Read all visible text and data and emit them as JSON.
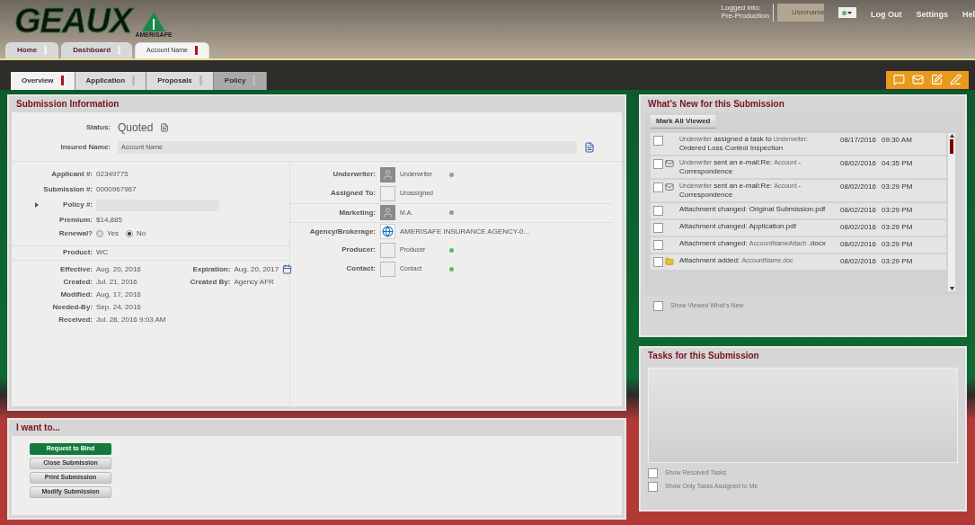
{
  "header": {
    "logo": "GEAUX",
    "logo_sub": "AMERISAFE",
    "login_lines": [
      "Logged into:",
      "Pre-Production"
    ],
    "username": "Username",
    "links": [
      "Log Out",
      "Settings",
      "Hel"
    ]
  },
  "top_tabs": [
    {
      "label": "Home",
      "selected": false
    },
    {
      "label": "Dashboard",
      "selected": false
    },
    {
      "label": "Account Name",
      "selected": true
    }
  ],
  "sub_tabs": [
    {
      "label": "Overview",
      "selected": true
    },
    {
      "label": "Application",
      "selected": false
    },
    {
      "label": "Proposals",
      "selected": false
    },
    {
      "label": "Policy",
      "selected": false
    }
  ],
  "submission": {
    "title": "Submission Information",
    "status_label": "Status:",
    "status": "Quoted",
    "insured_label": "Insured Name:",
    "insured": "Account Name",
    "ids": [
      {
        "label": "Applicant #:",
        "value": "02349775",
        "kind": "text"
      },
      {
        "label": "Submission #:",
        "value": "0000967967",
        "kind": "text"
      },
      {
        "label": "Policy #:",
        "kind": "field"
      },
      {
        "label": "Premium:",
        "value": "$14,885",
        "kind": "text"
      }
    ],
    "renewal": {
      "label": "Renewal?",
      "options": [
        {
          "label": "Yes",
          "selected": false
        },
        {
          "label": "No",
          "selected": true
        }
      ]
    },
    "product": {
      "label": "Product:",
      "value": "WC"
    },
    "dates_left": [
      {
        "label": "Effective:",
        "value": "Aug. 20, 2016"
      },
      {
        "label": "Created:",
        "value": "Jul. 21, 2016"
      },
      {
        "label": "Modified:",
        "value": "Aug. 17, 2016"
      },
      {
        "label": "Needed-By:",
        "value": "Sep. 24, 2016"
      },
      {
        "label": "Received:",
        "value": "Jul. 28, 2016 9:03 AM"
      }
    ],
    "dates_right": [
      {
        "label": "Expiration:",
        "value": "Aug. 20, 2017",
        "kind": "calendar"
      },
      {
        "label": "Created By:",
        "value": "Agency AFR",
        "kind": "text"
      }
    ],
    "contacts": [
      {
        "label": "Underwriter:",
        "value": "Underwriter",
        "kind": "person",
        "color": "#9a9a9a"
      },
      {
        "label": "Assigned To:",
        "value": "Unassigned",
        "kind": "blank"
      },
      {
        "label": "Marketing:",
        "value": "M.A.",
        "kind": "person",
        "color": "#9a9a9a"
      },
      {
        "label": "Agency/Brokerage:",
        "value": "AMERISAFE INSURANCE AGENCY-0...",
        "kind": "agency"
      },
      {
        "label": "Producer:",
        "value": "Producer",
        "kind": "blank",
        "color": "#5cb85c"
      },
      {
        "label": "Contact:",
        "value": "Contact",
        "kind": "blank",
        "color": "#5cb85c"
      }
    ]
  },
  "actions": {
    "title": "I want to...",
    "buttons": [
      {
        "label": "Request to Bind",
        "kind": "primary"
      },
      {
        "label": "Close Submission",
        "kind": "normal"
      },
      {
        "label": "Print Submission",
        "kind": "normal"
      },
      {
        "label": "Modify Submission",
        "kind": "normal"
      }
    ]
  },
  "whats_new": {
    "title": "What's New for this Submission",
    "mark_all": "Mark All Viewed",
    "items": [
      {
        "checked": false,
        "kind": "task",
        "parts": [
          {
            "kind": "small",
            "text": "Underwriter"
          },
          {
            "kind": "normal",
            "text": "assigned a task to"
          },
          {
            "kind": "small",
            "text": "Underwriter:"
          },
          {
            "kind": "normal",
            "text": "Ordered Loss Control Inspection"
          }
        ],
        "date": "08/17/2016",
        "time": "09:30 AM"
      },
      {
        "checked": false,
        "kind": "email",
        "parts": [
          {
            "kind": "small",
            "text": "Underwriter"
          },
          {
            "kind": "normal",
            "text": "sent an e-mail:Re:"
          },
          {
            "kind": "small",
            "text": "Account"
          },
          {
            "kind": "normal",
            "text": "-"
          },
          {
            "kind": "normal",
            "text": "Correspondence"
          }
        ],
        "date": "08/02/2016",
        "time": "04:35 PM"
      },
      {
        "checked": false,
        "kind": "email",
        "parts": [
          {
            "kind": "small",
            "text": "Underwriter"
          },
          {
            "kind": "normal",
            "text": "sent an e-mail:Re:"
          },
          {
            "kind": "small",
            "text": "Account"
          },
          {
            "kind": "normal",
            "text": "-"
          },
          {
            "kind": "normal",
            "text": "Correspondence"
          }
        ],
        "date": "08/02/2016",
        "time": "03:29 PM"
      },
      {
        "checked": false,
        "kind": "change",
        "parts": [
          {
            "kind": "normal",
            "text": "Attachment changed: Original Submission.pdf"
          }
        ],
        "date": "08/02/2016",
        "time": "03:29 PM"
      },
      {
        "checked": false,
        "kind": "change",
        "parts": [
          {
            "kind": "normal",
            "text": "Attachment changed:"
          },
          {
            "kind": "normal",
            "text": "Application.pdf"
          }
        ],
        "date": "08/02/2016",
        "time": "03:29 PM"
      },
      {
        "checked": false,
        "kind": "change",
        "parts": [
          {
            "kind": "normal",
            "text": "Attachment changed:"
          },
          {
            "kind": "small",
            "text": "AccountNameAttach"
          },
          {
            "kind": "normal",
            "text": ".docx"
          }
        ],
        "date": "08/02/2016",
        "time": "03:29 PM"
      },
      {
        "checked": false,
        "kind": "attachment",
        "parts": [
          {
            "kind": "normal",
            "text": "Attachment added:"
          },
          {
            "kind": "small",
            "text": "AccountName.doc"
          }
        ],
        "date": "08/02/2016",
        "time": "03:29 PM"
      }
    ],
    "show_viewed": {
      "label": "Show Viewed What's New",
      "checked": false
    }
  },
  "tasks": {
    "title": "Tasks for this Submission",
    "options": [
      {
        "label": "Show Resolved Tasks",
        "checked": false
      },
      {
        "label": "Show Only Tasks Assigned to Me",
        "checked": false
      }
    ]
  }
}
